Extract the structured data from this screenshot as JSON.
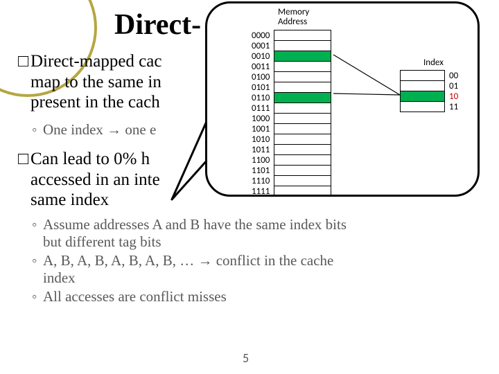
{
  "title": "Direct-",
  "bullets": {
    "b1_l1_prefix": "Direct-mapped cac",
    "b1_l2": "map to the same in",
    "b1_l3": "present in the cach",
    "sub1": "One index → one e",
    "b2_l1": "Can lead to 0% h",
    "b2_l2": "accessed in an inte",
    "b2_l3": "same index",
    "b2_tail_char": "e",
    "sub2a_l1": "Assume addresses A and B have the same index bits",
    "sub2a_l2": "but different tag bits",
    "sub2b_l1": "A, B, A, B, A, B, A, B, … → conflict in the cache",
    "sub2b_l2": "index",
    "sub2c": "All accesses are conflict misses"
  },
  "square": "□",
  "ring": "◦",
  "page_number": "5",
  "diagram": {
    "mem_label_l1": "Memory",
    "mem_label_l2": "Address",
    "index_label": "Index",
    "mem_addresses": [
      "0000",
      "0001",
      "0010",
      "0011",
      "0100",
      "0101",
      "0110",
      "0111",
      "1000",
      "1001",
      "1010",
      "1011",
      "1100",
      "1101",
      "1110",
      "1111"
    ],
    "mem_highlight": [
      2,
      6
    ],
    "index_labels": [
      "00",
      "01",
      "10",
      "11"
    ],
    "index_highlight": [
      2
    ]
  }
}
